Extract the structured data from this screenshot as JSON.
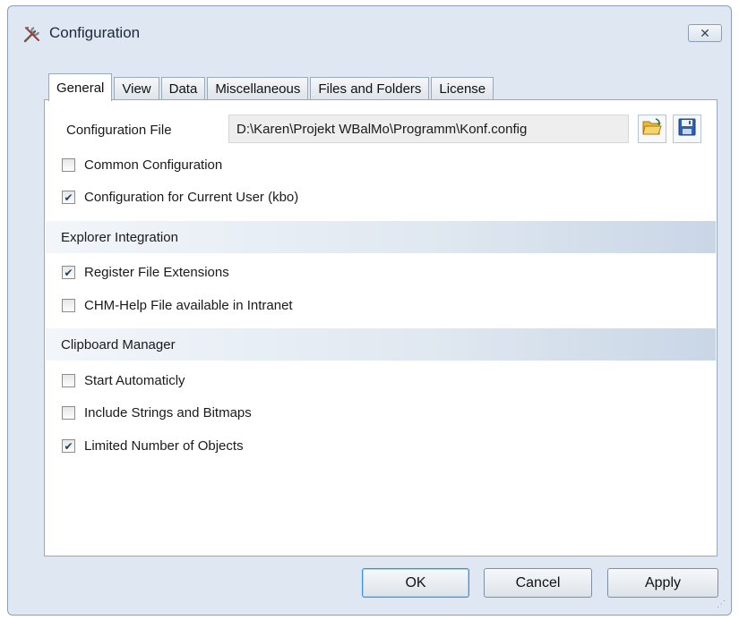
{
  "window": {
    "title": "Configuration",
    "title_icon": "tools-icon",
    "close_glyph": "✕"
  },
  "tabs": [
    {
      "label": "General",
      "active": true
    },
    {
      "label": "View",
      "active": false
    },
    {
      "label": "Data",
      "active": false
    },
    {
      "label": "Miscellaneous",
      "active": false
    },
    {
      "label": "Files and Folders",
      "active": false
    },
    {
      "label": "License",
      "active": false
    }
  ],
  "general": {
    "config_file_label": "Configuration File",
    "config_file_path": "D:\\Karen\\Projekt WBalMo\\Programm\\Konf.config",
    "open_icon": "folder-open-icon",
    "save_icon": "floppy-save-icon",
    "common_config": {
      "label": "Common Configuration",
      "checked": false
    },
    "current_user_config": {
      "label": "Configuration for Current User (kbo)",
      "checked": true
    }
  },
  "explorer": {
    "header": "Explorer Integration",
    "register_ext": {
      "label": "Register File Extensions",
      "checked": true
    },
    "chm_help": {
      "label": "CHM-Help File available in Intranet",
      "checked": false
    }
  },
  "clipboard": {
    "header": "Clipboard Manager",
    "start_auto": {
      "label": "Start Automaticly",
      "checked": false
    },
    "include_strings": {
      "label": "Include Strings and Bitmaps",
      "checked": false
    },
    "limited_objects": {
      "label": "Limited Number of Objects",
      "checked": true
    }
  },
  "buttons": {
    "ok": "OK",
    "cancel": "Cancel",
    "apply": "Apply"
  },
  "colors": {
    "accent": "#3d8fd6",
    "section_band": "#c9d6e6",
    "window_bg": "#dfe8f2"
  }
}
